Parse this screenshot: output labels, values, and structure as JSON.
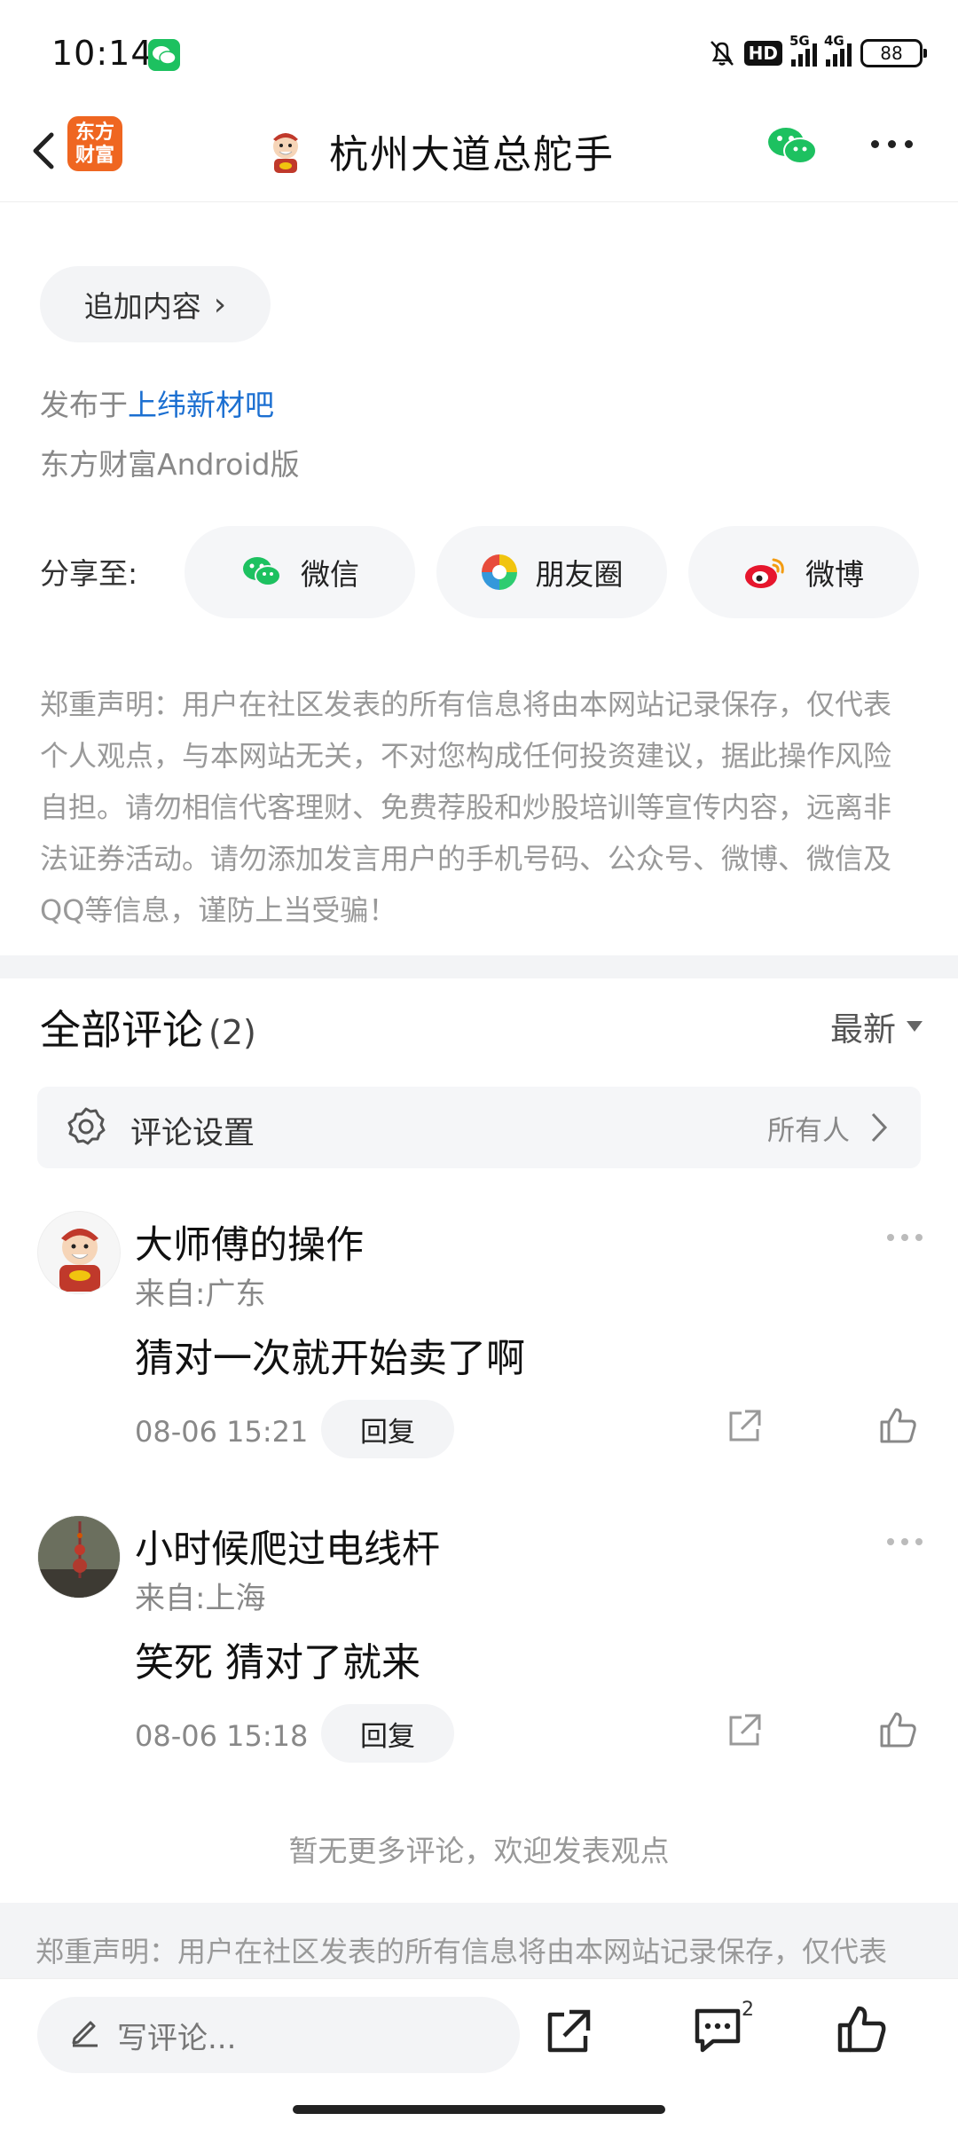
{
  "status_bar": {
    "time": "10:14",
    "hd": "HD",
    "net1": "5G",
    "net2": "4G",
    "battery": "88"
  },
  "header": {
    "logo_text_line1": "东方",
    "logo_text_line2": "财富",
    "title": "杭州大道总舵手"
  },
  "post": {
    "add_content": "追加内容",
    "posted_prefix": "发布于",
    "posted_board": "上纬新材吧",
    "client": "东方财富Android版"
  },
  "share": {
    "label": "分享至:",
    "buttons": [
      {
        "label": "微信",
        "icon": "wechat-icon"
      },
      {
        "label": "朋友圈",
        "icon": "moments-icon"
      },
      {
        "label": "微博",
        "icon": "weibo-icon"
      }
    ]
  },
  "disclaimer": "郑重声明：用户在社区发表的所有信息将由本网站记录保存，仅代表个人观点，与本网站无关，不对您构成任何投资建议，据此操作风险自担。请勿相信代客理财、免费荐股和炒股培训等宣传内容，远离非法证券活动。请勿添加发言用户的手机号码、公众号、微博、微信及QQ等信息，谨防上当受骗！",
  "comments_section": {
    "title": "全部评论",
    "count": "(2)",
    "sort": "最新",
    "settings_label": "评论设置",
    "settings_value": "所有人",
    "items": [
      {
        "name": "大师傅的操作",
        "from": "来自:广东",
        "text": "猜对一次就开始卖了啊",
        "time": "08-06 15:21",
        "reply": "回复"
      },
      {
        "name": "小时候爬过电线杆",
        "from": "来自:上海",
        "text": "笑死 猜对了就来",
        "time": "08-06 15:18",
        "reply": "回复"
      }
    ],
    "no_more": "暂无更多评论，欢迎发表观点"
  },
  "bottom_disclaimer": "郑重声明：用户在社区发表的所有信息将由本网站记录保存，仅代表",
  "bottom_bar": {
    "write_placeholder": "写评论...",
    "comment_count": "2"
  }
}
